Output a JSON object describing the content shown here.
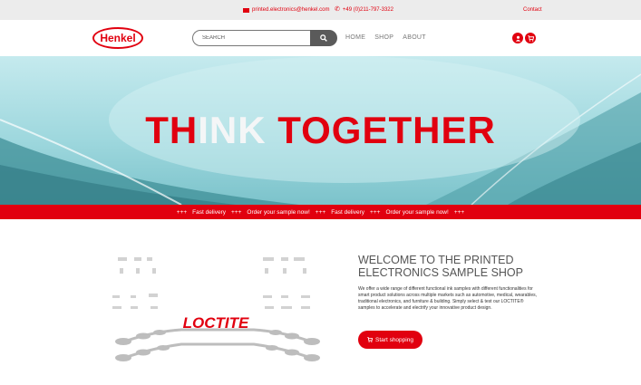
{
  "topbar": {
    "email": "printed.electronics@henkel.com",
    "phone": "+49 (0)211-797-3322",
    "contact": "Contact"
  },
  "nav": {
    "logo": "Henkel",
    "search_placeholder": "SEARCH",
    "menu": [
      "HOME",
      "SHOP",
      "ABOUT"
    ]
  },
  "hero": {
    "title_red_1": "TH",
    "title_light": "INK",
    "title_red_2": " TOGETHER"
  },
  "ticker": [
    "+++",
    "Fast delivery",
    "+++",
    "Order your sample now!",
    "+++",
    "Fast delivery",
    "+++",
    "Order your sample now!",
    "+++"
  ],
  "welcome": {
    "heading_line1": "WELCOME TO THE PRINTED",
    "heading_line2": "ELECTRONICS SAMPLE SHOP",
    "body": "We offer a wide range of different functional ink samples with different functionalities for smart product solutions across multiple markets such as automotive, medical, wearables, traditional electronics, and furniture & building. Simply select & test our LOCTITE® samples to accelerate and electrify your innovative product design.",
    "button": "Start shopping"
  },
  "product_image": {
    "brand": "LOCTITE"
  },
  "colors": {
    "accent": "#e1000f",
    "topbar": "#ececec",
    "search_button": "#5a5a5a"
  }
}
